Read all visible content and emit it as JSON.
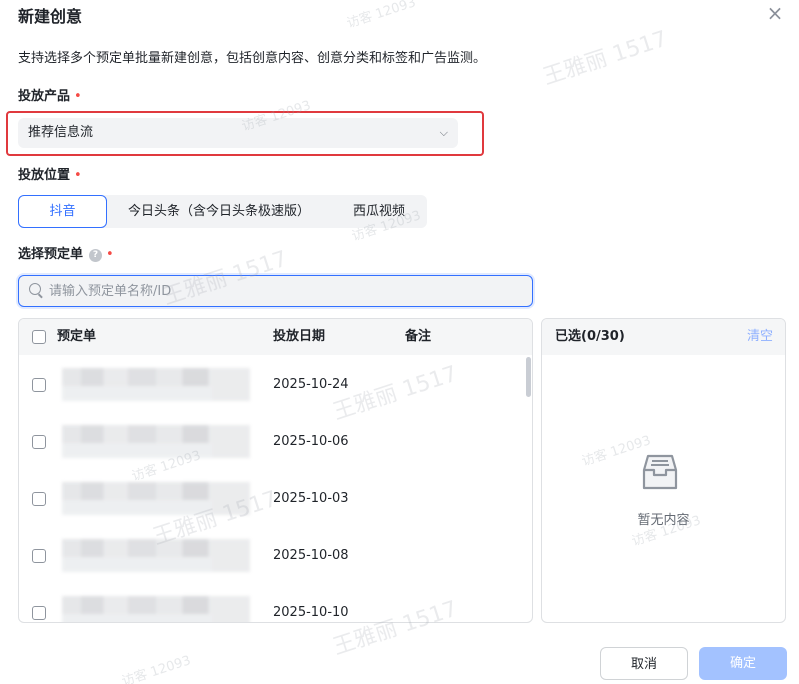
{
  "dialog": {
    "title": "新建创意",
    "close": "×",
    "description": "支持选择多个预定单批量新建创意，包括创意内容、创意分类和标签和广告监测。"
  },
  "product": {
    "label": "投放产品",
    "required": "•",
    "value": "推荐信息流",
    "chevron": "⌵"
  },
  "placement": {
    "label": "投放位置",
    "required": "•",
    "options": [
      "抖音",
      "今日头条（含今日头条极速版）",
      "西瓜视频"
    ],
    "selected": "抖音"
  },
  "orders": {
    "label": "选择预定单",
    "help": "?",
    "required": "•",
    "search_placeholder": "请输入预定单名称/ID",
    "columns": [
      "预定单",
      "投放日期",
      "备注"
    ],
    "rows": [
      {
        "date": "2025-10-24"
      },
      {
        "date": "2025-10-06"
      },
      {
        "date": "2025-10-03"
      },
      {
        "date": "2025-10-08"
      },
      {
        "date": "2025-10-10"
      }
    ]
  },
  "selected_panel": {
    "title": "已选(0/30)",
    "clear": "清空",
    "empty": "暂无内容"
  },
  "footer": {
    "cancel": "取消",
    "ok": "确定"
  },
  "watermark": {
    "name": "王雅丽 1517",
    "visitor": "访客 12093"
  },
  "colors": {
    "primary": "#3370ff",
    "highlight": "#e0393e",
    "required": "#f54a45"
  }
}
